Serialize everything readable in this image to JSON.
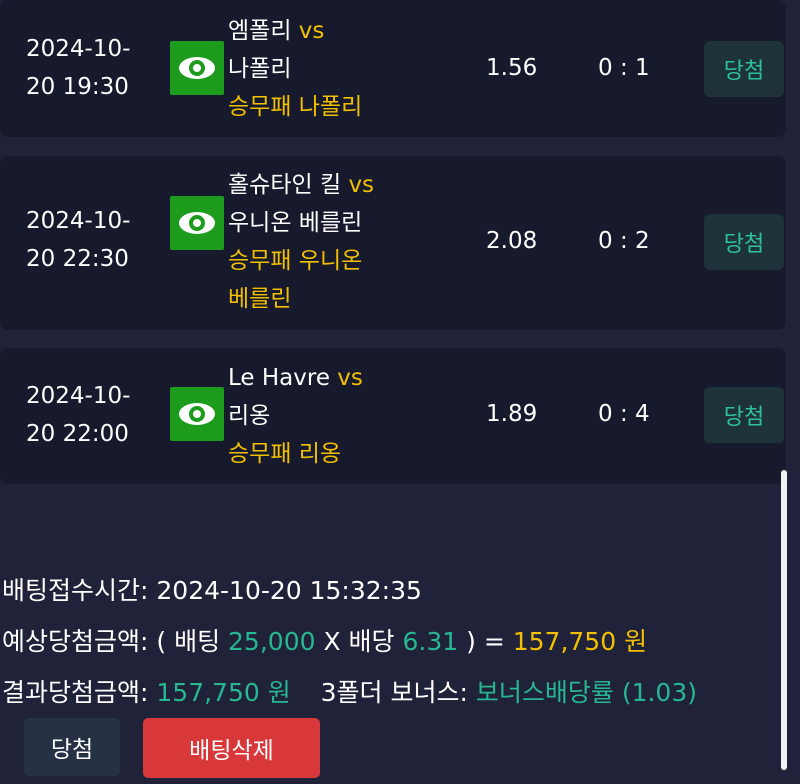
{
  "matches": [
    {
      "date": "2024-10-",
      "time": "20 19:30",
      "home": "엠폴리",
      "vs": "vs",
      "away": "나폴리",
      "pick": "승무패 나폴리",
      "odds": "1.56",
      "score": "0 : 1",
      "result": "당첨"
    },
    {
      "date": "2024-10-",
      "time": "20 22:30",
      "home": "홀슈타인 킬",
      "vs": "vs",
      "away": "우니온 베를린",
      "pick_line1": "승무패 우니온",
      "pick_line2": "베를린",
      "odds": "2.08",
      "score": "0 : 2",
      "result": "당첨"
    },
    {
      "date": "2024-10-",
      "time": "20 22:00",
      "home": "Le Havre",
      "vs": "vs",
      "away": "리옹",
      "pick": "승무패 리옹",
      "odds": "1.89",
      "score": "0 : 4",
      "result": "당첨"
    }
  ],
  "summary": {
    "bet_time_label": "배팅접수시간:",
    "bet_time_value": "2024-10-20 15:32:35",
    "expected_label": "예상당첨금액: ( 배팅",
    "bet_amount": "25,000",
    "x_label": "X 배당",
    "total_odds": "6.31",
    "eq": ") =",
    "expected_amount": "157,750 원",
    "result_label": "결과당첨금액:",
    "result_amount": "157,750 원",
    "bonus_label": "3폴더 보너스:",
    "bonus_value": "보너스배당률 (1.03)"
  },
  "buttons": {
    "win": "당첨",
    "delete": "배팅삭제"
  },
  "colors": {
    "background": "#1f2238",
    "card": "#161a2c",
    "gold": "#f2c000",
    "teal": "#27b793",
    "eye_bg": "#1c9b1c",
    "delete_bg": "#d9383b"
  }
}
